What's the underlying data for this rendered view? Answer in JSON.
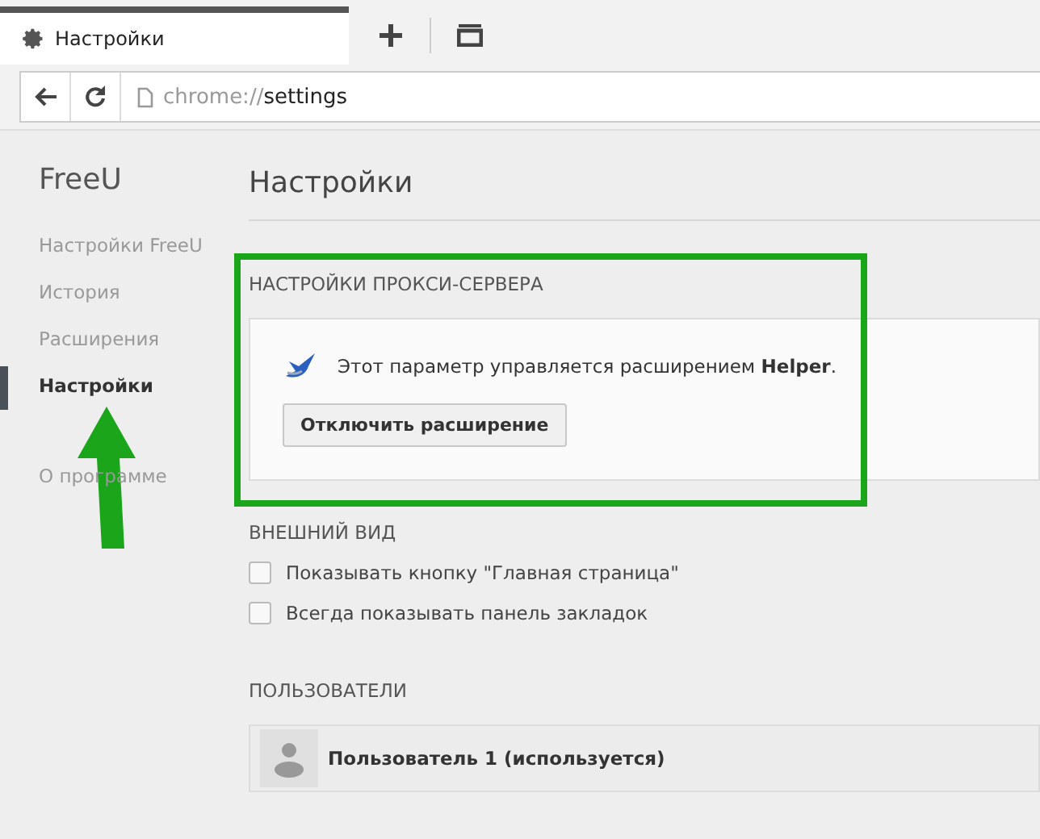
{
  "tab": {
    "title": "Настройки"
  },
  "address": {
    "scheme": "chrome://",
    "path": "settings"
  },
  "sidebar": {
    "title": "FreeU",
    "items": [
      {
        "label": "Настройки FreeU",
        "selected": false
      },
      {
        "label": "История",
        "selected": false
      },
      {
        "label": "Расширения",
        "selected": false
      },
      {
        "label": "Настройки",
        "selected": true
      },
      {
        "label": "О программе",
        "selected": false
      }
    ]
  },
  "page_title": "Настройки",
  "proxy": {
    "heading": "НАСТРОЙКИ ПРОКСИ-СЕРВЕРА",
    "message": "Этот параметр управляется расширением **Helper**.",
    "button": "Отключить расширение",
    "highlighted": true
  },
  "appearance": {
    "heading": "ВНЕШНИЙ ВИД",
    "options": [
      {
        "label": "Показывать кнопку \"Главная страница\"",
        "checked": false
      },
      {
        "label": "Всегда показывать панель закладок",
        "checked": false
      }
    ]
  },
  "users": {
    "heading": "ПОЛЬЗОВАТЕЛИ",
    "items": [
      {
        "name": "Пользователь 1 (используется)"
      }
    ]
  }
}
